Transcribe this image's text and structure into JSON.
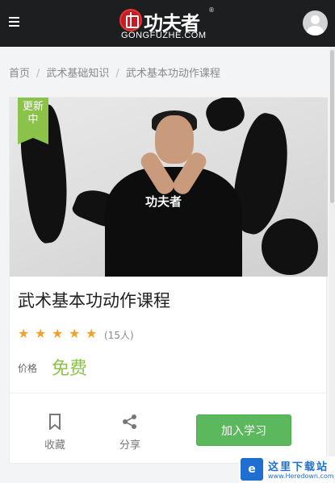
{
  "header": {
    "logo_cn": "功夫者",
    "logo_reg": "®",
    "logo_en": "GONGFUZHE.COM"
  },
  "breadcrumb": {
    "items": [
      "首页",
      "武术基础知识",
      "武术基本功动作课程"
    ],
    "separator": "/"
  },
  "course": {
    "status_badge": "更新中",
    "shirt_text": "功夫者",
    "title": "武术基本功动作课程",
    "rating": 5,
    "rating_count": "(15人)",
    "price_label": "价格",
    "price": "免费"
  },
  "actions": {
    "bookmark_label": "收藏",
    "share_label": "分享",
    "join_label": "加入学习"
  },
  "watermark": {
    "logo": "e",
    "name": "这里下载站",
    "url": "www.Heredown.com"
  },
  "colors": {
    "header_bg": "#1d1e1f",
    "accent_green": "#8bc34a",
    "button_green": "#5cb85c",
    "star": "#f2a22c"
  },
  "icons": [
    "menu-icon",
    "avatar-icon",
    "bookmark-icon",
    "share-icon",
    "star-icon"
  ]
}
